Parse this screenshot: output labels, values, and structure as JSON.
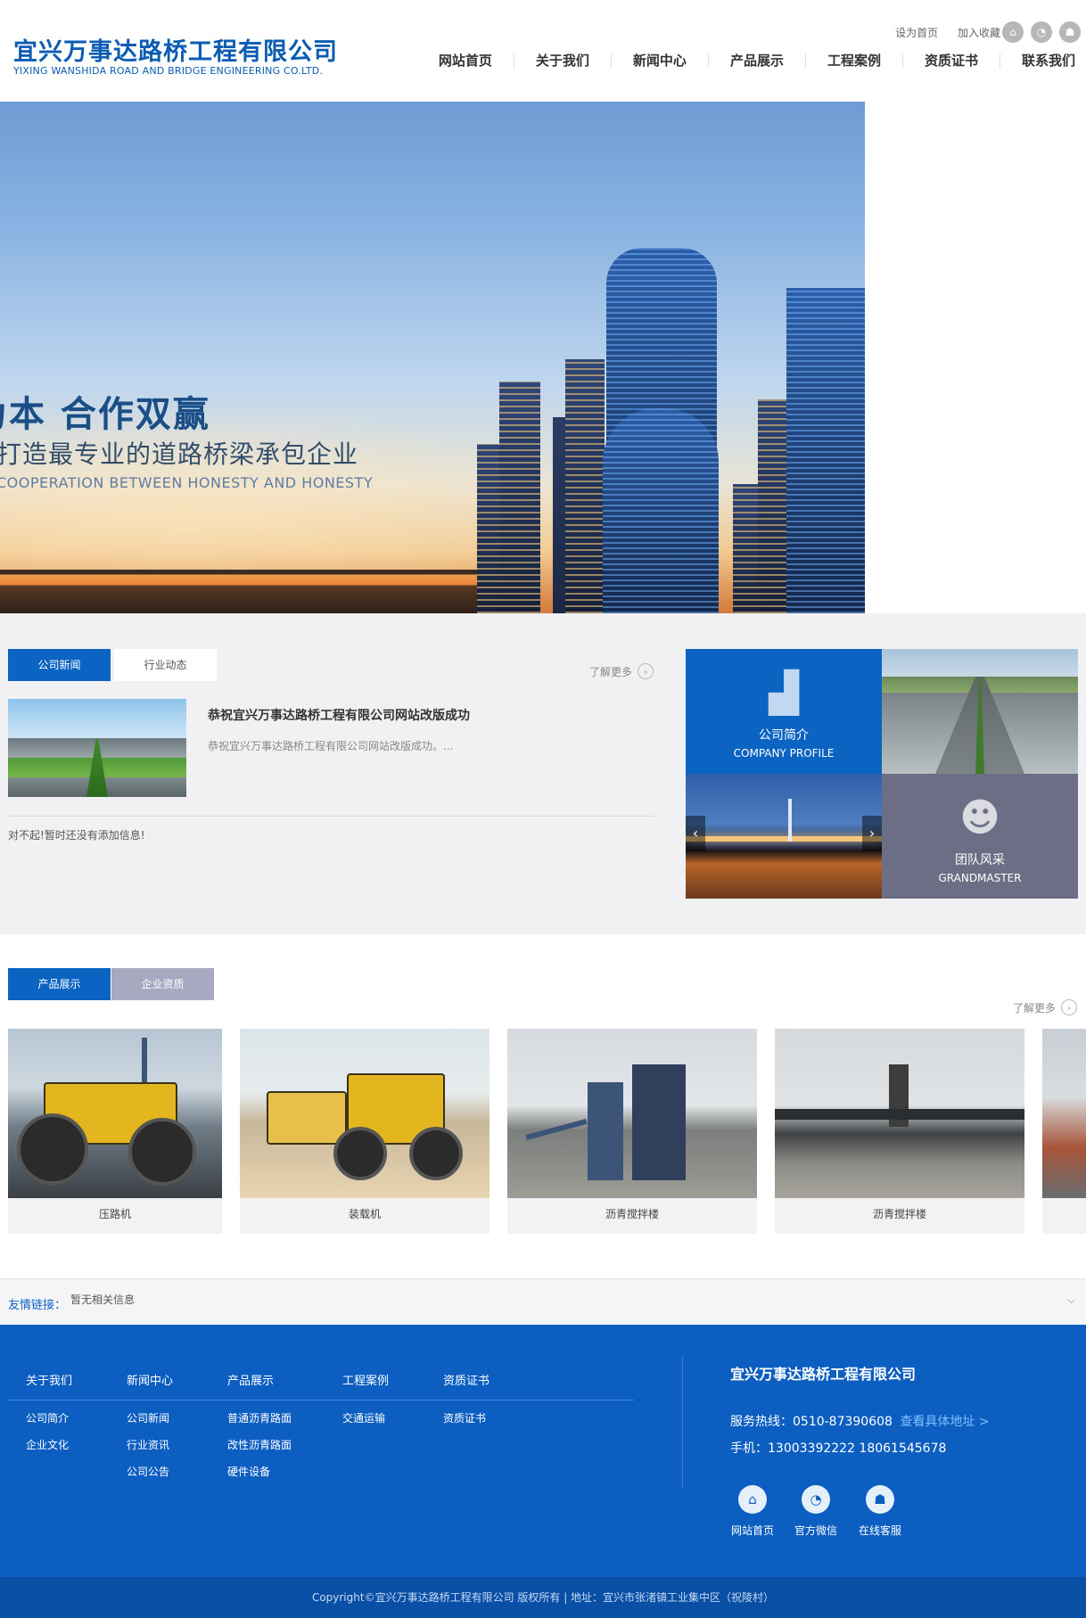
{
  "header": {
    "logo_cn": "宜兴万事达路桥工程有限公司",
    "logo_en": "YIXING WANSHIDA ROAD AND BRIDGE ENGINEERING CO.LTD.",
    "top_links": [
      "设为首页",
      "加入收藏"
    ],
    "social_icons": [
      "home-icon",
      "wechat-icon",
      "qq-icon"
    ],
    "nav": [
      "网站首页",
      "关于我们",
      "新闻中心",
      "产品展示",
      "工程案例",
      "资质证书",
      "联系我们"
    ]
  },
  "banner": {
    "line1": "为本 合作双赢",
    "line2": "打造最专业的道路桥梁承包企业",
    "line3": "COOPERATION BETWEEN HONESTY AND HONESTY"
  },
  "news": {
    "tabs": [
      "公司新闻",
      "行业动态"
    ],
    "more": "了解更多",
    "featured_title": "恭祝宜兴万事达路桥工程有限公司网站改版成功",
    "featured_summary": "恭祝宜兴万事达路桥工程有限公司网站改版成功。...",
    "empty_text": "对不起!暂时还没有添加信息!"
  },
  "about": {
    "profile_cn": "公司简介",
    "profile_en": "COMPANY PROFILE",
    "team_cn": "团队风采",
    "team_en": "GRANDMASTER"
  },
  "products": {
    "tabs": [
      "产品展示",
      "企业资质"
    ],
    "more": "了解更多",
    "items": [
      "压路机",
      "装载机",
      "沥青搅拌楼",
      "沥青搅拌楼"
    ]
  },
  "links": {
    "label": "友情链接：",
    "value": "暂无相关信息"
  },
  "footer": {
    "columns": [
      {
        "title": "关于我们",
        "items": [
          "公司简介",
          "企业文化"
        ]
      },
      {
        "title": "新闻中心",
        "items": [
          "公司新闻",
          "行业资讯",
          "公司公告"
        ]
      },
      {
        "title": "产品展示",
        "items": [
          "普通沥青路面",
          "改性沥青路面",
          "硬件设备"
        ]
      },
      {
        "title": "工程案例",
        "items": [
          "交通运输"
        ]
      },
      {
        "title": "资质证书",
        "items": [
          "资质证书"
        ]
      }
    ],
    "company": "宜兴万事达路桥工程有限公司",
    "hotline": "服务热线：0510-87390608",
    "address_link": "查看具体地址 >",
    "mobile": "手机：13003392222 18061545678",
    "icons": [
      {
        "icon": "home-icon",
        "label": "网站首页"
      },
      {
        "icon": "wechat-icon",
        "label": "官方微信"
      },
      {
        "icon": "qq-icon",
        "label": "在线客服"
      }
    ],
    "copyright": "Copyright©宜兴万事达路桥工程有限公司 版权所有 | 地址：宜兴市张渚镇工业集中区（祝陵村）"
  }
}
